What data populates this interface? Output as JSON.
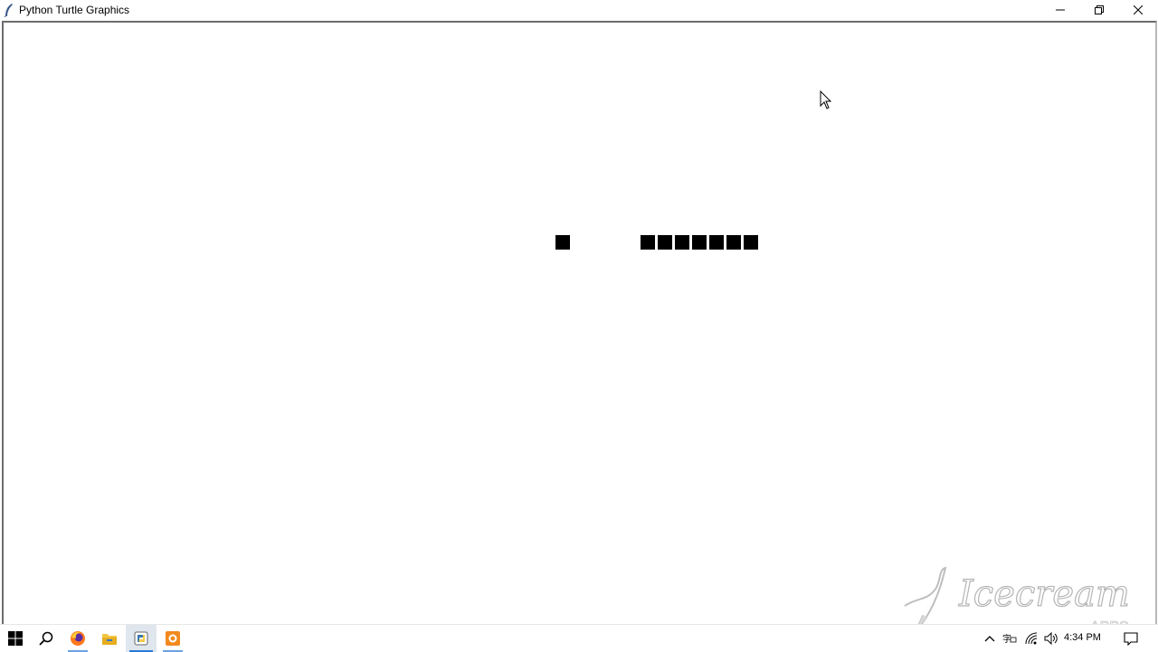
{
  "window": {
    "title": "Python Turtle Graphics"
  },
  "canvas": {
    "food_color": "#000000",
    "snake_color": "#000000",
    "snake_segments": 7,
    "background": "#ffffff"
  },
  "taskbar": {
    "items": [
      {
        "name": "start-icon"
      },
      {
        "name": "search-icon"
      },
      {
        "name": "firefox-icon"
      },
      {
        "name": "file-explorer-icon"
      },
      {
        "name": "python-icon"
      },
      {
        "name": "icecream-recorder-icon"
      }
    ],
    "clock": "4:34 PM"
  }
}
